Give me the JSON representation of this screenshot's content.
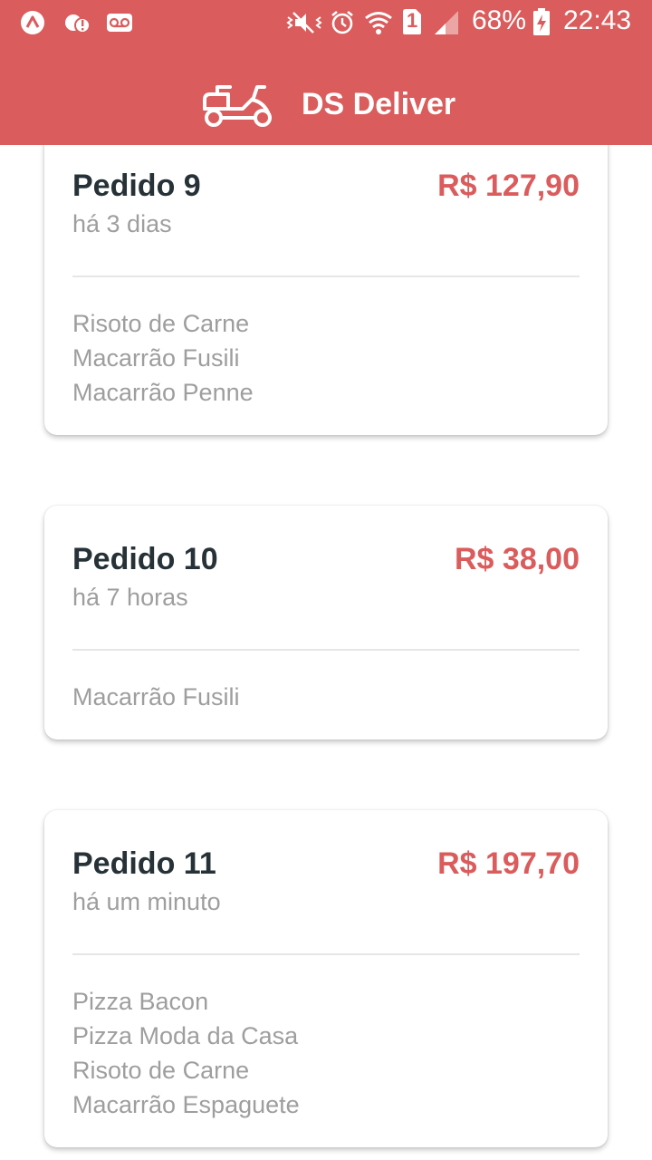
{
  "status_bar": {
    "left_icons": [
      "app-a-icon",
      "alert-badge-icon",
      "voicemail-icon"
    ],
    "right_icons": [
      "vibrate-icon",
      "alarm-icon",
      "wifi-icon",
      "sim-1-icon",
      "signal-icon",
      "battery-charging-icon"
    ],
    "sim_label": "1",
    "battery": "68%",
    "time": "22:43"
  },
  "header": {
    "logo_icon": "delivery-scooter-icon",
    "title": "DS Deliver"
  },
  "colors": {
    "brand": "#DA5C5C",
    "title_text": "#263238",
    "muted_text": "#9E9E9E",
    "divider": "#E6E6E6"
  },
  "orders": [
    {
      "title": "Pedido 9",
      "price": "R$ 127,90",
      "time": "há 3 dias",
      "items": [
        "Risoto de Carne",
        "Macarrão Fusili",
        "Macarrão Penne"
      ]
    },
    {
      "title": "Pedido 10",
      "price": "R$ 38,00",
      "time": "há 7 horas",
      "items": [
        "Macarrão Fusili"
      ]
    },
    {
      "title": "Pedido 11",
      "price": "R$ 197,70",
      "time": "há um minuto",
      "items": [
        "Pizza Bacon",
        "Pizza Moda da Casa",
        "Risoto de Carne",
        "Macarrão Espaguete"
      ]
    }
  ]
}
